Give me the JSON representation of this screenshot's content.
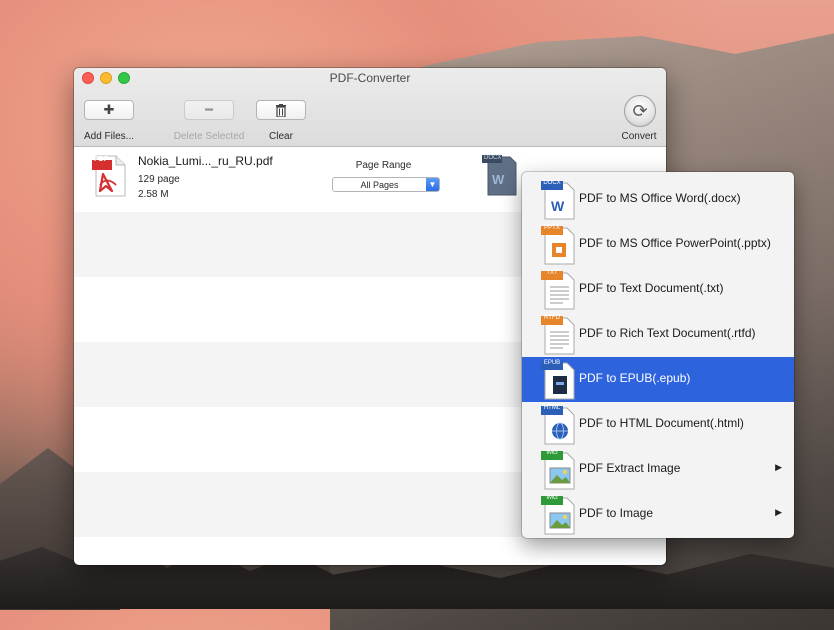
{
  "window": {
    "title": "PDF-Converter"
  },
  "toolbar": {
    "add_files_label": "Add Files...",
    "delete_selected_label": "Delete Selected",
    "clear_label": "Clear",
    "convert_label": "Convert"
  },
  "file": {
    "icon_badge": "PDF",
    "name": "Nokia_Lumi..._ru_RU.pdf",
    "pages": "129 page",
    "size": "2.58 M",
    "page_range_label": "Page Range",
    "page_range_value": "All Pages",
    "target_format_badge": "DOCX",
    "target_format_letter": "W"
  },
  "menu": {
    "items": [
      {
        "badge": "DOCX",
        "label": "PDF to MS Office Word(.docx)",
        "icon": "word-document-icon",
        "color": "#2b5fb8"
      },
      {
        "badge": "PPTX",
        "label": "PDF to MS Office PowerPoint(.pptx)",
        "icon": "powerpoint-document-icon",
        "color": "#e6852a"
      },
      {
        "badge": "TXT",
        "label": "PDF to Text Document(.txt)",
        "icon": "text-document-icon",
        "color": "#e6852a"
      },
      {
        "badge": "RTFD",
        "label": "PDF to Rich Text Document(.rtfd)",
        "icon": "rich-text-document-icon",
        "color": "#e6852a"
      },
      {
        "badge": "EPUB",
        "label": "PDF to EPUB(.epub)",
        "icon": "epub-document-icon",
        "color": "#2b5fb8"
      },
      {
        "badge": "HTML",
        "label": "PDF to HTML Document(.html)",
        "icon": "html-document-icon",
        "color": "#2b5fb8"
      },
      {
        "badge": "IMG",
        "label": "PDF Extract Image",
        "icon": "image-document-icon",
        "color": "#2f9a3a"
      },
      {
        "badge": "IMG",
        "label": "PDF to Image",
        "icon": "image-document-icon",
        "color": "#2f9a3a"
      }
    ],
    "submenu_arrow": "▶"
  },
  "colors": {
    "selection": "#2e63de",
    "accent_blue": "#2b5fb8",
    "pdf_red": "#d62f2f"
  }
}
